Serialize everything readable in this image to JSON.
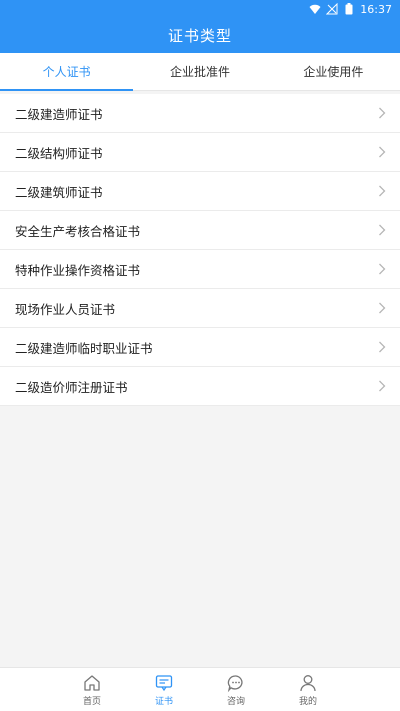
{
  "status_bar": {
    "time": "16:37",
    "icons": [
      "wifi-icon",
      "no-signal-icon",
      "battery-icon"
    ]
  },
  "header": {
    "title": "证书类型"
  },
  "tabs": [
    {
      "label": "个人证书",
      "active": true
    },
    {
      "label": "企业批准件",
      "active": false
    },
    {
      "label": "企业使用件",
      "active": false
    }
  ],
  "list": {
    "items": [
      {
        "label": "二级建造师证书"
      },
      {
        "label": "二级结构师证书"
      },
      {
        "label": "二级建筑师证书"
      },
      {
        "label": "安全生产考核合格证书"
      },
      {
        "label": "特种作业操作资格证书"
      },
      {
        "label": "现场作业人员证书"
      },
      {
        "label": "二级建造师临时职业证书"
      },
      {
        "label": "二级造价师注册证书"
      }
    ]
  },
  "bottom_nav": {
    "items": [
      {
        "label": "首页",
        "icon": "home-icon",
        "active": false
      },
      {
        "label": "证书",
        "icon": "certificate-icon",
        "active": true
      },
      {
        "label": "咨询",
        "icon": "chat-icon",
        "active": false
      },
      {
        "label": "我的",
        "icon": "user-icon",
        "active": false
      }
    ]
  },
  "colors": {
    "accent": "#2f93f5",
    "background": "#f4f4f4"
  }
}
